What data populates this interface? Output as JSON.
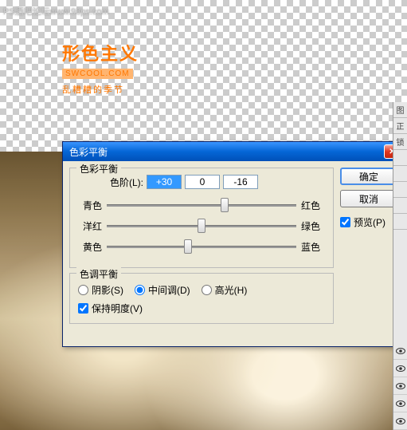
{
  "watermark": "PS酒吧论坛www.98ps.com",
  "logo": {
    "main": "形色主义",
    "url": "SWCOOL.COM",
    "sub": "乱糟糟的季节"
  },
  "dialog": {
    "title": "色彩平衡",
    "group_balance": "色彩平衡",
    "levels_label": "色阶(L):",
    "levels": {
      "r": "+30",
      "g": "0",
      "b": "-16"
    },
    "sliders": [
      {
        "left": "青色",
        "right": "红色",
        "pos": 62
      },
      {
        "left": "洋红",
        "right": "绿色",
        "pos": 50
      },
      {
        "left": "黄色",
        "right": "蓝色",
        "pos": 43
      }
    ],
    "group_tone": "色调平衡",
    "tones": {
      "shadow": "阴影(S)",
      "mid": "中间调(D)",
      "hi": "高光(H)",
      "selected": "mid"
    },
    "preserve": "保持明度(V)",
    "ok": "确定",
    "cancel": "取消",
    "preview": "预览(P)"
  },
  "panel": {
    "stubs": [
      "图",
      "正",
      "锁"
    ]
  }
}
